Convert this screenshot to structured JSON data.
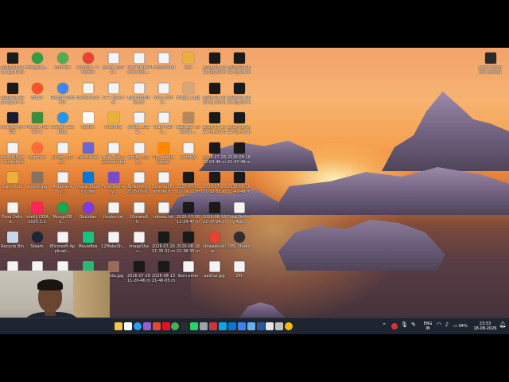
{
  "desktop": {
    "icons": [
      {
        "label": "2026-07-01 11-10-40.mkv",
        "icon": "video-file-icon",
        "color": "#1a1a1a"
      },
      {
        "label": "mongodb...",
        "icon": "mongodb-icon",
        "color": "#2f9e44"
      },
      {
        "label": "uTorrent",
        "icon": "utorrent-icon",
        "color": "#4caf50"
      },
      {
        "label": "Antidup - Chrome",
        "icon": "chrome-icon",
        "color": "#e94235"
      },
      {
        "label": "photo_2022...",
        "icon": "image-file-icon",
        "color": "#f4f4f4"
      },
      {
        "label": "restaurant-form-and-...",
        "icon": "file-icon",
        "color": "#f4f4f4"
      },
      {
        "label": "FoodDev.txt",
        "icon": "text-file-icon",
        "color": "#f4f4f4"
      },
      {
        "label": "aha",
        "icon": "folder-icon",
        "color": "#e8b23a"
      },
      {
        "label": "2026-07-26 11-05-59.mkv",
        "icon": "video-file-icon",
        "color": "#1a1a1a"
      },
      {
        "label": "2026-07-26 21-43-24.mkv",
        "icon": "video-file-icon",
        "color": "#1a1a1a"
      },
      {
        "label": "2026-07-26 11-56-57.mkv",
        "icon": "video-file-icon",
        "color": "#1a1a1a"
      },
      {
        "label": "Brave",
        "icon": "brave-icon",
        "color": "#fb542b"
      },
      {
        "label": "Google Chrome",
        "icon": "chrome-icon",
        "color": "#4285f4"
      },
      {
        "label": "backend.txt",
        "icon": "text-file-icon",
        "color": "#f4f4f4"
      },
      {
        "label": "c++ code.txt",
        "icon": "text-file-icon",
        "color": "#f4f4f4"
      },
      {
        "label": "Backend(file).txt",
        "icon": "text-file-icon",
        "color": "#f4f4f4"
      },
      {
        "label": "food_items...",
        "icon": "text-file-icon",
        "color": "#f4f4f4"
      },
      {
        "label": "image_1.jpg",
        "icon": "image-file-icon",
        "color": "#d7a77a"
      },
      {
        "label": "2026-07-30 19-54-09.mkv",
        "icon": "video-file-icon",
        "color": "#1a1a1a"
      },
      {
        "label": "2026-07-30 21-05-09.mkv",
        "icon": "video-file-icon",
        "color": "#1a1a1a"
      },
      {
        "label": "Antigravity IDE",
        "icon": "antigravity-icon",
        "color": "#1b1b2f"
      },
      {
        "label": "Process Hacker 2",
        "icon": "process-hacker-icon",
        "color": "#3c8d3c"
      },
      {
        "label": "Docker Desktop",
        "icon": "docker-icon",
        "color": "#2496ed"
      },
      {
        "label": "Notion",
        "icon": "notion-icon",
        "color": "#ffffff"
      },
      {
        "label": "meoffice",
        "icon": "folder-icon",
        "color": "#e8b23a"
      },
      {
        "label": "photo_2022...",
        "icon": "image-file-icon",
        "color": "#f4f4f4"
      },
      {
        "label": "team-Work...",
        "icon": "file-icon",
        "color": "#f4f4f4"
      },
      {
        "label": "Bachelor 2026-02-...",
        "icon": "image-file-icon",
        "color": "#b28a5e"
      },
      {
        "label": "2026-07-29 21-04-09.mkv",
        "icon": "video-file-icon",
        "color": "#1a1a1a"
      },
      {
        "label": "2026-06-05 21-05-45.mkv",
        "icon": "video-file-icon",
        "color": "#1a1a1a"
      },
      {
        "label": "food delivery socket.txt",
        "icon": "text-file-icon",
        "color": "#f4f4f4"
      },
      {
        "label": "Postman",
        "icon": "postman-icon",
        "color": "#ff6c37"
      },
      {
        "label": "photo_2022...",
        "icon": "image-file-icon",
        "color": "#f4f4f4"
      },
      {
        "label": "Excalidraw",
        "icon": "excalidraw-icon",
        "color": "#6965db"
      },
      {
        "label": "New Text Document.txt",
        "icon": "text-file-icon",
        "color": "#f4f4f4"
      },
      {
        "label": "photo_2022...",
        "icon": "image-file-icon",
        "color": "#f4f4f4"
      },
      {
        "label": "VLC media player",
        "icon": "vlc-icon",
        "color": "#ff8800"
      },
      {
        "label": "script.js",
        "icon": "text-file-icon",
        "color": "#f4f4f4"
      },
      {
        "label": "2026-07-28 12-03-48.mkv",
        "icon": "video-file-icon",
        "color": "#1a1a1a"
      },
      {
        "label": "2026-08-18 21-47-48.mkv",
        "icon": "video-file-icon",
        "color": "#1a1a1a"
      },
      {
        "label": "logos food",
        "icon": "folder-icon",
        "color": "#e8b23a"
      },
      {
        "label": "anaraj.jpg",
        "icon": "image-file-icon",
        "color": "#8a7060"
      },
      {
        "label": "Antigravity...",
        "icon": "text-file-icon",
        "color": "#f4f4f4"
      },
      {
        "label": "Visual Studio Code",
        "icon": "vscode-icon",
        "color": "#0078d4"
      },
      {
        "label": "Food Delivery...",
        "icon": "file-icon",
        "color": "#7a4bc6"
      },
      {
        "label": "Screenshot 2026-05-0...",
        "icon": "image-file-icon",
        "color": "#f4f4f4"
      },
      {
        "label": "External Examiner.d...",
        "icon": "file-icon",
        "color": "#f4f4f4"
      },
      {
        "label": "2026-07-25 11-29-22.mkv",
        "icon": "video-file-icon",
        "color": "#1a1a1a"
      },
      {
        "label": "2026-07-28 21-32-52.mkv",
        "icon": "video-file-icon",
        "color": "#1a1a1a"
      },
      {
        "label": "2026-08-18 21-42-49.mkv",
        "icon": "video-file-icon",
        "color": "#1a1a1a"
      },
      {
        "label": "Food Delive...",
        "icon": "text-file-icon",
        "color": "#f4f4f4"
      },
      {
        "label": "IntelliJ IDEA 2025.3.1",
        "icon": "intellij-icon",
        "color": "#fe2857"
      },
      {
        "label": "MongoDBC...",
        "icon": "mongodb-compass-icon",
        "color": "#13aa52"
      },
      {
        "label": "ObsIdian",
        "icon": "obsidian-icon",
        "color": "#7c3aed"
      },
      {
        "label": "foodev.txt",
        "icon": "text-file-icon",
        "color": "#f4f4f4"
      },
      {
        "label": "10makeSh...",
        "icon": "file-icon",
        "color": "#f4f4f4"
      },
      {
        "label": "mbase.txt",
        "icon": "text-file-icon",
        "color": "#f4f4f4"
      },
      {
        "label": "2026-07-26 11-29-47.mkv",
        "icon": "video-file-icon",
        "color": "#1a1a1a"
      },
      {
        "label": "2026-08-18 21-37-24.mkv",
        "icon": "video-file-icon",
        "color": "#1a1a1a"
      },
      {
        "label": "Food Delivery App...",
        "icon": "text-file-icon",
        "color": "#f4f4f4"
      },
      {
        "label": "Recycle Bin",
        "icon": "recycle-bin-icon",
        "color": "#c8d6e8"
      },
      {
        "label": "Steam",
        "icon": "steam-icon",
        "color": "#1b2838"
      },
      {
        "label": "Microsoft Applicati...",
        "icon": "text-file-icon",
        "color": "#f4f4f4"
      },
      {
        "label": "MovieBox",
        "icon": "moviebox-icon",
        "color": "#19c37d"
      },
      {
        "label": "12MakeSh...",
        "icon": "text-file-icon",
        "color": "#f4f4f4"
      },
      {
        "label": "imageShar...",
        "icon": "text-file-icon",
        "color": "#f4f4f4"
      },
      {
        "label": "2026-07-26 11-35-32.mkv",
        "icon": "video-file-icon",
        "color": "#1a1a1a"
      },
      {
        "label": "2026-08-18 21-38-35.mkv",
        "icon": "video-file-icon",
        "color": "#1a1a1a"
      },
      {
        "label": "shiwalikcollm...",
        "icon": "chrome-icon",
        "color": "#e94235"
      },
      {
        "label": "OBS Studio",
        "icon": "obs-icon",
        "color": "#302e31"
      },
      {
        "label": "Food",
        "icon": "text-file-icon",
        "color": "#f4f4f4"
      },
      {
        "label": "PromptEdu",
        "icon": "text-file-icon",
        "color": "#f4f4f4"
      },
      {
        "label": "Grand Theft V Lite",
        "icon": "text-file-icon",
        "color": "#f4f4f4"
      },
      {
        "label": "Open Design release-03...",
        "icon": "open-design-icon",
        "color": "#2bb673"
      },
      {
        "label": "rapida.jpg",
        "icon": "image-file-icon",
        "color": "#9b6b5a"
      },
      {
        "label": "2026-07-26 11-20-46.mkv",
        "icon": "video-file-icon",
        "color": "#1a1a1a"
      },
      {
        "label": "2026-08-13 21-40-05.mkv",
        "icon": "video-file-icon",
        "color": "#1a1a1a"
      },
      {
        "label": "ltem emer",
        "icon": "text-file-icon",
        "color": "#f4f4f4"
      },
      {
        "label": "aadhar.jpg",
        "icon": "image-file-icon",
        "color": "#f4f4f4"
      },
      {
        "label": "2fit",
        "icon": "text-file-icon",
        "color": "#f4f4f4"
      },
      {
        "label": "2026-07-31 19-45-35.mkv",
        "icon": "video-file-icon",
        "color": "#1a1a1a"
      },
      {
        "label": "2026-08-13 21-38-26.mkv",
        "icon": "video-file-icon",
        "color": "#1a1a1a"
      },
      {
        "label": "Learn about this picture",
        "icon": "learn-picture-icon",
        "color": "#2a2a2a"
      }
    ]
  },
  "taskbar": {
    "apps": [
      {
        "name": "file-explorer-icon",
        "color": "#f6c445"
      },
      {
        "name": "store-icon",
        "color": "#ffffff"
      },
      {
        "name": "edge-icon",
        "color": "#2a9df4"
      },
      {
        "name": "copilot-icon",
        "color": "#9a5bd6"
      },
      {
        "name": "office-icon",
        "color": "#e8472b"
      },
      {
        "name": "gem-icon",
        "color": "#e81123"
      },
      {
        "name": "chrome-icon",
        "color": "#4caf50"
      },
      {
        "name": "terminal-icon",
        "color": "#2b2b2b"
      },
      {
        "name": "whatsapp-icon",
        "color": "#25d366"
      },
      {
        "name": "settings-icon",
        "color": "#9aa3ad"
      },
      {
        "name": "red-app-icon",
        "color": "#d13438"
      },
      {
        "name": "photos-icon",
        "color": "#0ea5e9"
      },
      {
        "name": "vscode-icon",
        "color": "#0078d4"
      },
      {
        "name": "calculator-icon",
        "color": "#3b82f6"
      },
      {
        "name": "desktop-app-icon",
        "color": "#5fb3f0"
      },
      {
        "name": "word-icon",
        "color": "#2b579a"
      },
      {
        "name": "notion-icon",
        "color": "#e5e5e5"
      },
      {
        "name": "obs-icon",
        "color": "#c0c0c0"
      },
      {
        "name": "chrome-alt-icon",
        "color": "#fbbc05"
      }
    ],
    "tray": {
      "language_line1": "ENG",
      "language_line2": "IN",
      "battery": "94%",
      "time": "23:53",
      "date": "18-08-2026"
    }
  }
}
